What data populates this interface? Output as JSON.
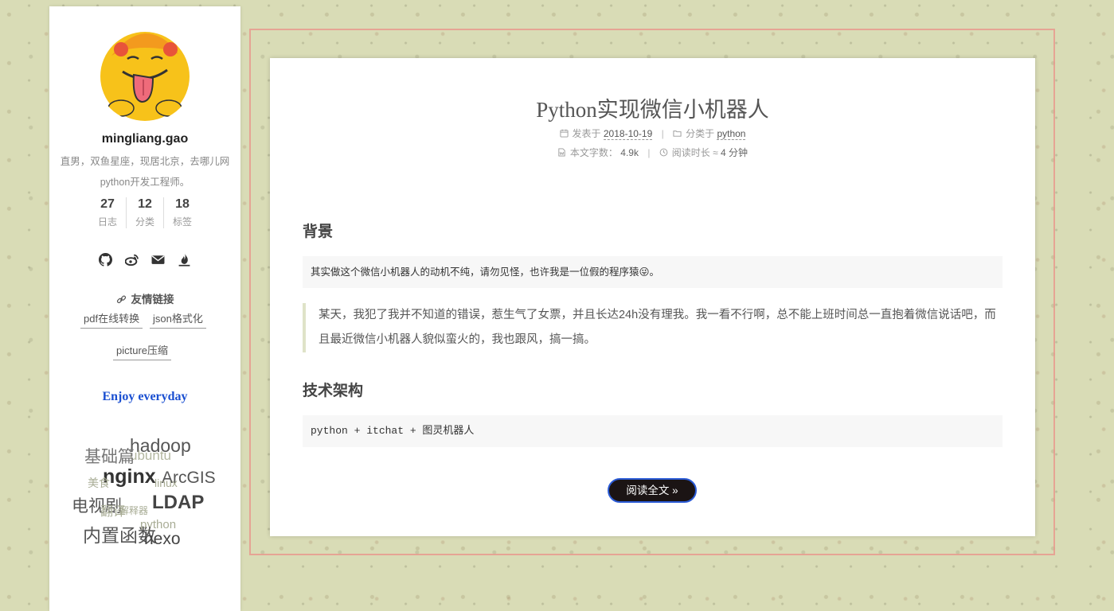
{
  "sidebar": {
    "author_name": "mingliang.gao",
    "author_desc": "直男，双鱼星座，现居北京，去哪儿网python开发工程师。",
    "stats": [
      {
        "count": "27",
        "label": "日志"
      },
      {
        "count": "12",
        "label": "分类"
      },
      {
        "count": "18",
        "label": "标签"
      }
    ],
    "socials": [
      "github-icon",
      "weibo-icon",
      "envelope-icon",
      "fire-icon"
    ],
    "links_title": "友情链接",
    "links": [
      "pdf在线转换",
      "json格式化",
      "picture压缩"
    ],
    "motto": "Enjoy everyday",
    "tags": [
      "hadoop",
      "ubuntu",
      "基础篇",
      "nginx",
      "ArcGIS",
      "美食",
      "linux",
      "电视剧",
      "LDAP",
      "翻译",
      "解释器",
      "python",
      "内置函数",
      "hexo"
    ]
  },
  "post": {
    "title": "Python实现微信小机器人",
    "posted_label": "发表于",
    "posted_date": "2018-10-19",
    "category_label": "分类于",
    "category": "python",
    "wordcount_label": "本文字数：",
    "wordcount": "4.9k",
    "readtime_label": "阅读时长 ≈",
    "readtime": "4 分钟",
    "section1_heading": "背景",
    "note_text": "其实做这个微信小机器人的动机不纯，请勿见怪，也许我是一位假的程序猿😜。",
    "quote_text": "某天，我犯了我并不知道的错误，惹生气了女票，并且长达24h没有理我。我一看不行啊，总不能上班时间总一直抱着微信说话吧，而且最近微信小机器人貌似蛮火的，我也跟风，搞一搞。",
    "section2_heading": "技术架构",
    "code_text": "python + itchat + 图灵机器人",
    "read_more_label": "阅读全文 »"
  },
  "colors": {
    "accent_blue": "#1a4fd1",
    "button_bg": "#1b1414",
    "button_border": "#2b5bd6",
    "frame_border": "#e8968c"
  }
}
